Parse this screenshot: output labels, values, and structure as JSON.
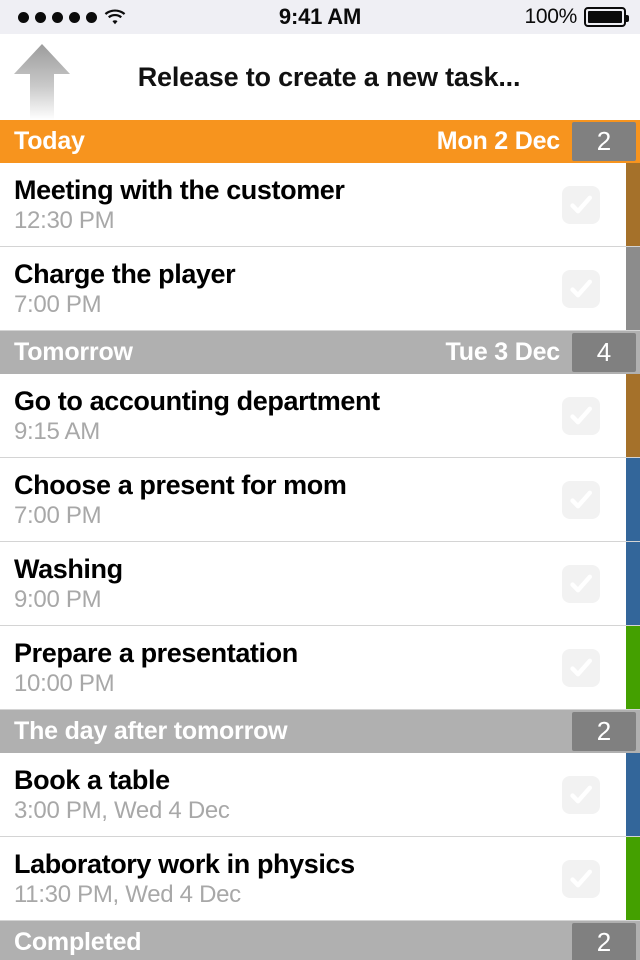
{
  "status_bar": {
    "signal_dots": 5,
    "wifi_icon": "wifi-icon",
    "time": "9:41 AM",
    "battery_percent": "100%",
    "battery_icon": "battery-full-icon",
    "background_color": "#EFEFF4"
  },
  "pull_to_refresh": {
    "arrow_icon": "arrow-up-icon",
    "label": "Release to create a new task..."
  },
  "colors": {
    "today_header": "#F7941E",
    "section_header": "#B0B0B0",
    "badge": "#808080",
    "strip_brown": "#A5712A",
    "strip_gray": "#8C8C8C",
    "strip_blue": "#33669A",
    "strip_green": "#44A000",
    "title_text": "#000000",
    "time_text": "#A8A8A8",
    "checkbox_bg": "#F2F2F2"
  },
  "sections": [
    {
      "title": "Today",
      "date": "Mon 2 Dec",
      "count": "2",
      "style": "today",
      "tasks": [
        {
          "title": "Meeting with the customer",
          "time": "12:30 PM",
          "strip": "#A5712A",
          "checkbox": "checkbox-unchecked"
        },
        {
          "title": "Charge the player",
          "time": "7:00 PM",
          "strip": "#8C8C8C",
          "checkbox": "checkbox-unchecked"
        }
      ]
    },
    {
      "title": "Tomorrow",
      "date": "Tue 3 Dec",
      "count": "4",
      "style": "plain",
      "tasks": [
        {
          "title": "Go to accounting department",
          "time": "9:15 AM",
          "strip": "#A5712A",
          "checkbox": "checkbox-unchecked"
        },
        {
          "title": "Choose a present for mom",
          "time": "7:00 PM",
          "strip": "#33669A",
          "checkbox": "checkbox-unchecked"
        },
        {
          "title": "Washing",
          "time": "9:00 PM",
          "strip": "#33669A",
          "checkbox": "checkbox-unchecked"
        },
        {
          "title": "Prepare a presentation",
          "time": "10:00 PM",
          "strip": "#44A000",
          "checkbox": "checkbox-unchecked"
        }
      ]
    },
    {
      "title": "The day after tomorrow",
      "date": "",
      "count": "2",
      "style": "plain",
      "tasks": [
        {
          "title": "Book a table",
          "time": "3:00 PM, Wed 4 Dec",
          "strip": "#33669A",
          "checkbox": "checkbox-unchecked"
        },
        {
          "title": "Laboratory work in physics",
          "time": "11:30 PM, Wed 4 Dec",
          "strip": "#44A000",
          "checkbox": "checkbox-unchecked"
        }
      ]
    },
    {
      "title": "Completed",
      "date": "",
      "count": "2",
      "style": "plain",
      "tasks": []
    }
  ]
}
